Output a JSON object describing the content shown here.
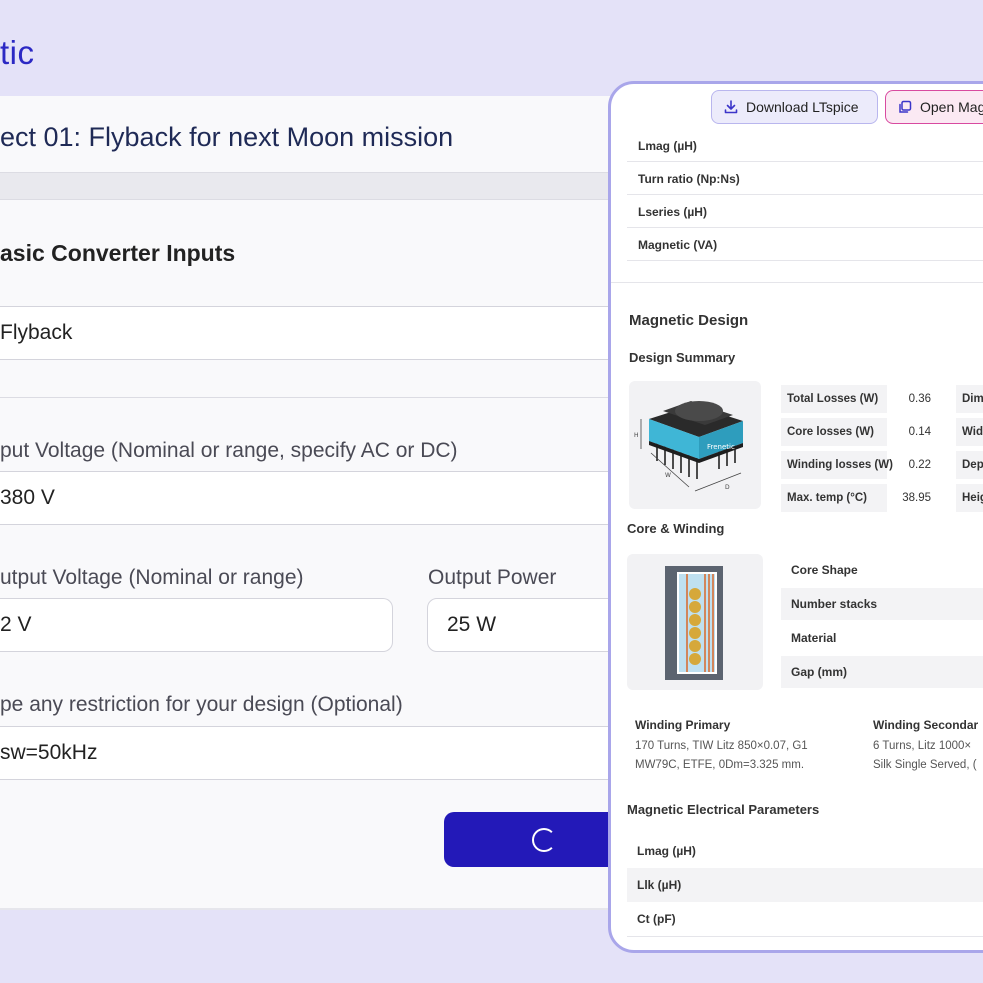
{
  "brand": {
    "text": "tic"
  },
  "project": {
    "title": "ect 01: Flyback for next Moon mission"
  },
  "form": {
    "section_title": "asic Converter Inputs",
    "topology_value": "Flyback",
    "input_voltage_label": "put Voltage (Nominal or range, specify AC or DC)",
    "input_voltage_value": "380 V",
    "output_voltage_label": "utput Voltage (Nominal or range)",
    "output_voltage_value": "2 V",
    "output_power_label": "Output Power",
    "output_power_value": "25 W",
    "restriction_label": "pe any restriction for your design (Optional)",
    "restriction_value": "sw=50kHz"
  },
  "panel": {
    "download_label": "Download LTspice",
    "open_label": "Open Mag",
    "top_rows": [
      "Lmag (µH)",
      "Turn ratio (Np:Ns)",
      "Lseries (µH)",
      "Magnetic (VA)"
    ],
    "magnetic_design_title": "Magnetic Design",
    "design_summary_title": "Design Summary",
    "summary": [
      {
        "label": "Total Losses (W)",
        "value": "0.36",
        "right": "Dim"
      },
      {
        "label": "Core losses (W)",
        "value": "0.14",
        "right": "Wid"
      },
      {
        "label": "Winding losses (W)",
        "value": "0.22",
        "right": "Dep"
      },
      {
        "label": "Max. temp (°C)",
        "value": "38.95",
        "right": "Heig"
      }
    ],
    "core_winding_title": "Core & Winding",
    "core_rows": [
      "Core Shape",
      "Number stacks",
      "Material",
      "Gap (mm)"
    ],
    "winding_primary_title": "Winding Primary",
    "winding_primary_line1": "170 Turns, TIW Litz 850×0.07, G1",
    "winding_primary_line2": "MW79C, ETFE, 0Dm=3.325 mm.",
    "winding_secondary_title": "Winding Secondar",
    "winding_secondary_line1": "6 Turns, Litz 1000×",
    "winding_secondary_line2": "Silk Single Served, (",
    "electrical_title": "Magnetic Electrical Parameters",
    "electrical_rows": [
      "Lmag (µH)",
      "Llk (µH)",
      "Ct (pF)"
    ]
  },
  "colors": {
    "accent": "#2319b8",
    "panel_border": "#a9a6ea",
    "open_border": "#d84aa0",
    "background": "#e4e2f8"
  }
}
